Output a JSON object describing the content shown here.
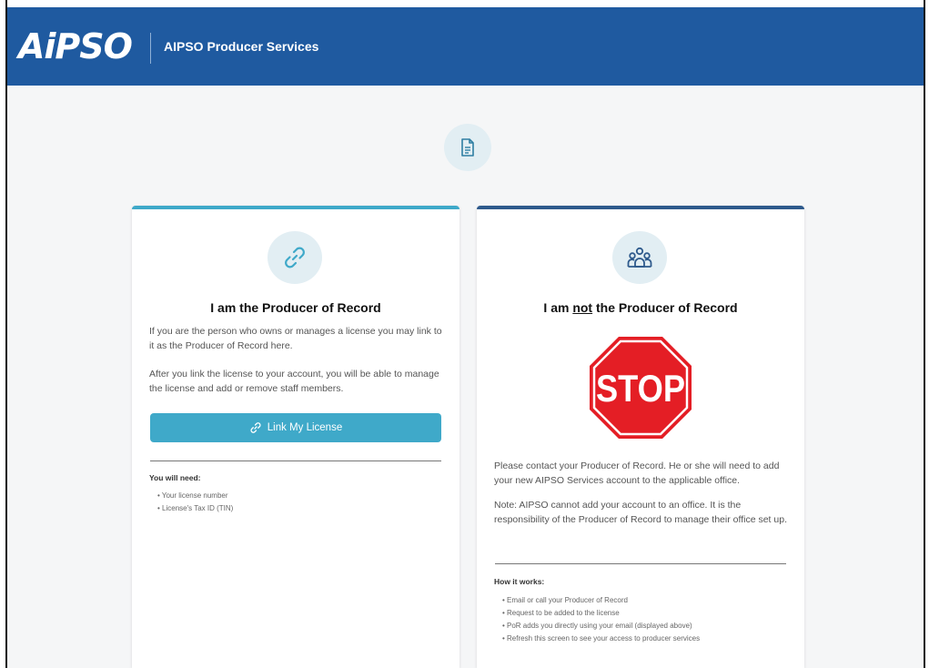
{
  "header": {
    "logo_text": "AiPSO",
    "title": "AIPSO Producer Services",
    "background": "#1f5aa0"
  },
  "top_icon": "document-icon",
  "producer_card": {
    "icon": "link-icon",
    "title": "I am the Producer of Record",
    "para1": "If you are the person who owns or manages a license you may link to it as the Producer of Record here.",
    "para2": "After you link the license to your account, you will be able to manage the license and add or remove staff members.",
    "button_label": "Link My License",
    "accent": "#3fa9c9",
    "need_heading": "You will need:",
    "need_items": [
      "• Your license number",
      "• License's Tax ID (TIN)"
    ]
  },
  "not_producer_card": {
    "icon": "users-icon",
    "title_prefix": "I am ",
    "title_underlined": "not",
    "title_suffix": " the Producer of Record",
    "stop_text": "STOP",
    "para1": "Please contact your Producer of Record. He or she will need to add your new AIPSO Services account to the applicable office.",
    "para2": "Note: AIPSO cannot add your account to an office. It is the responsibility of the Producer of Record to manage their office set up.",
    "how_heading": "How it works:",
    "how_items": [
      "• Email or call your Producer of Record",
      "• Request to be added to the license",
      "• PoR adds you directly using your email (displayed above)",
      "• Refresh this screen to see your access to producer services"
    ],
    "accent": "#2e5a8c",
    "stop_color": "#e41e25"
  }
}
